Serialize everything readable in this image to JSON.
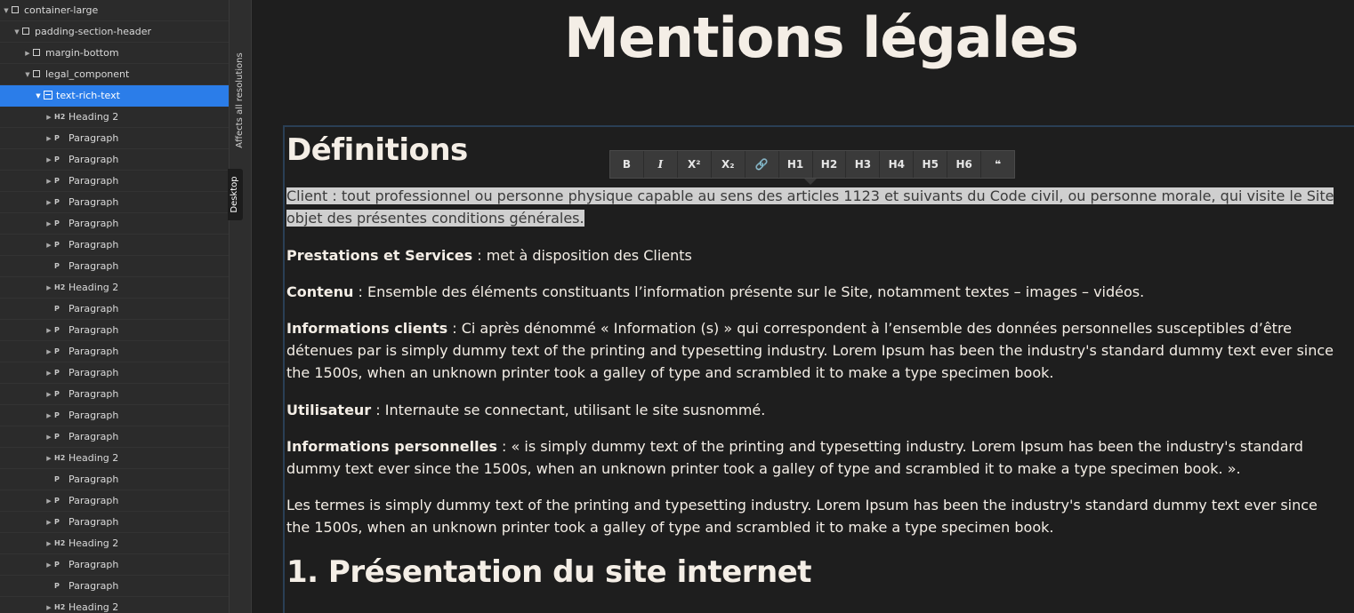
{
  "navigator": {
    "items": [
      {
        "label": "container-large",
        "tag": "",
        "depth": 0,
        "caret": "open",
        "icon": "box"
      },
      {
        "label": "padding-section-header",
        "tag": "",
        "depth": 1,
        "caret": "open",
        "icon": "box"
      },
      {
        "label": "margin-bottom",
        "tag": "",
        "depth": 2,
        "caret": "closed",
        "icon": "box"
      },
      {
        "label": "legal_component",
        "tag": "",
        "depth": 2,
        "caret": "open",
        "icon": "box"
      },
      {
        "label": "text-rich-text",
        "tag": "",
        "depth": 3,
        "caret": "open",
        "icon": "rich",
        "selected": true
      },
      {
        "label": "Heading 2",
        "tag": "H2",
        "depth": 4,
        "caret": "closed"
      },
      {
        "label": "Paragraph",
        "tag": "P",
        "depth": 4,
        "caret": "closed"
      },
      {
        "label": "Paragraph",
        "tag": "P",
        "depth": 4,
        "caret": "closed"
      },
      {
        "label": "Paragraph",
        "tag": "P",
        "depth": 4,
        "caret": "closed"
      },
      {
        "label": "Paragraph",
        "tag": "P",
        "depth": 4,
        "caret": "closed"
      },
      {
        "label": "Paragraph",
        "tag": "P",
        "depth": 4,
        "caret": "closed"
      },
      {
        "label": "Paragraph",
        "tag": "P",
        "depth": 4,
        "caret": "closed"
      },
      {
        "label": "Paragraph",
        "tag": "P",
        "depth": 4,
        "caret": "none"
      },
      {
        "label": "Heading 2",
        "tag": "H2",
        "depth": 4,
        "caret": "closed"
      },
      {
        "label": "Paragraph",
        "tag": "P",
        "depth": 4,
        "caret": "none"
      },
      {
        "label": "Paragraph",
        "tag": "P",
        "depth": 4,
        "caret": "closed"
      },
      {
        "label": "Paragraph",
        "tag": "P",
        "depth": 4,
        "caret": "closed"
      },
      {
        "label": "Paragraph",
        "tag": "P",
        "depth": 4,
        "caret": "closed"
      },
      {
        "label": "Paragraph",
        "tag": "P",
        "depth": 4,
        "caret": "closed"
      },
      {
        "label": "Paragraph",
        "tag": "P",
        "depth": 4,
        "caret": "closed"
      },
      {
        "label": "Paragraph",
        "tag": "P",
        "depth": 4,
        "caret": "closed"
      },
      {
        "label": "Heading 2",
        "tag": "H2",
        "depth": 4,
        "caret": "closed"
      },
      {
        "label": "Paragraph",
        "tag": "P",
        "depth": 4,
        "caret": "none"
      },
      {
        "label": "Paragraph",
        "tag": "P",
        "depth": 4,
        "caret": "closed"
      },
      {
        "label": "Paragraph",
        "tag": "P",
        "depth": 4,
        "caret": "closed"
      },
      {
        "label": "Heading 2",
        "tag": "H2",
        "depth": 4,
        "caret": "closed"
      },
      {
        "label": "Paragraph",
        "tag": "P",
        "depth": 4,
        "caret": "closed"
      },
      {
        "label": "Paragraph",
        "tag": "P",
        "depth": 4,
        "caret": "none"
      },
      {
        "label": "Heading 2",
        "tag": "H2",
        "depth": 4,
        "caret": "closed"
      }
    ]
  },
  "breakpoint": {
    "affects": "Affects all resolutions",
    "device": "Desktop"
  },
  "page": {
    "title": "Mentions légales"
  },
  "toolbar": {
    "buttons": [
      "B",
      "I",
      "X²",
      "X₂",
      "🔗",
      "H1",
      "H2",
      "H3",
      "H4",
      "H5",
      "H6",
      "❝"
    ]
  },
  "content": {
    "h2_definitions": "Définitions",
    "p_client": {
      "term": "Client",
      "text": " : tout professionnel ou personne physique capable au sens des articles 1123 et suivants du Code civil, ou personne morale, qui visite le Site objet des présentes conditions générales."
    },
    "p_prestations": {
      "term": "Prestations et Services",
      "text": " : met à disposition des Clients"
    },
    "p_contenu": {
      "term": "Contenu",
      "text": " : Ensemble des éléments constituants l’information présente sur le Site, notamment textes – images – vidéos."
    },
    "p_infos_clients": {
      "term": "Informations clients",
      "text": " : Ci après dénommé « Information (s) » qui correspondent à l’ensemble des données personnelles susceptibles d’être détenues par is simply dummy text of the printing and typesetting industry. Lorem Ipsum has been the industry's standard dummy text ever since the 1500s, when an unknown printer took a galley of type and scrambled it to make a type specimen book."
    },
    "p_utilisateur": {
      "term": "Utilisateur",
      "text": " : Internaute se connectant, utilisant le site susnommé."
    },
    "p_infos_perso": {
      "term": "Informations personnelles",
      "text": " : « is simply dummy text of the printing and typesetting industry. Lorem Ipsum has been the industry's standard dummy text ever since the 1500s, when an unknown printer took a galley of type and scrambled it to make a type specimen book. »."
    },
    "p_termes": "Les termes is simply dummy text of the printing and typesetting industry. Lorem Ipsum has been the industry's standard dummy text ever since the 1500s, when an unknown printer took a galley of type and scrambled it to make a type specimen book.",
    "h2_presentation": "1. Présentation du site internet"
  },
  "colors": {
    "selection": "#2b7de9",
    "canvas_bg": "#1e1e1e",
    "text": "#f4eee6",
    "highlight_bg": "#cfcfcf"
  }
}
